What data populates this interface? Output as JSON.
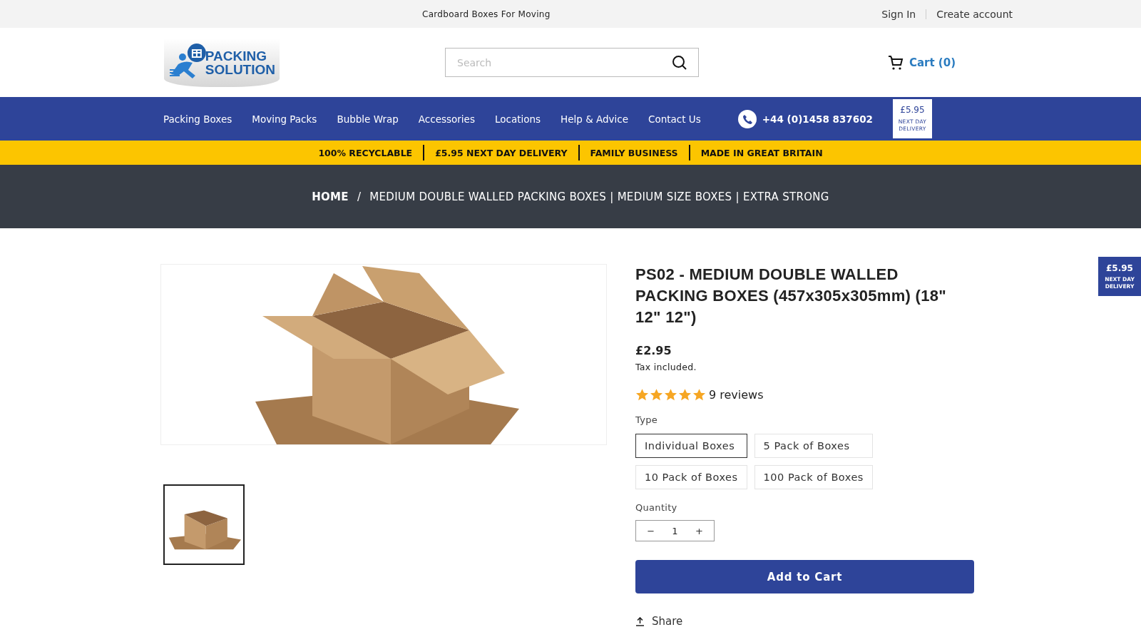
{
  "announcement": "Cardboard Boxes For Moving",
  "account_links": [
    "Sign In",
    "Create account"
  ],
  "logo": {
    "line_1": "PACKING",
    "line_2": "SOLUTION"
  },
  "search": {
    "placeholder": "Search"
  },
  "cart": {
    "label": "Cart (0)"
  },
  "nav": [
    {
      "label": "Packing Boxes"
    },
    {
      "label": "Moving Packs"
    },
    {
      "label": "Bubble Wrap"
    },
    {
      "label": "Accessories"
    },
    {
      "label": "Locations"
    },
    {
      "label": "Help & Advice"
    },
    {
      "label": "Contact Us"
    }
  ],
  "phone": "+44 (0)1458 837602",
  "delivery_badge": {
    "price": "£5.95",
    "line_1": "NEXT DAY",
    "line_2": "DELIVERY"
  },
  "usp_strip": [
    "100% RECYCLABLE",
    "£5.95 NEXT DAY DELIVERY",
    "FAMILY BUSINESS",
    "MADE IN GREAT BRITAIN"
  ],
  "breadcrumb": {
    "home": "HOME",
    "separator": "/",
    "current": "MEDIUM DOUBLE WALLED PACKING BOXES | MEDIUM SIZE BOXES | EXTRA STRONG"
  },
  "gallery": {
    "thumbnails": [
      {
        "selected": true
      }
    ]
  },
  "product": {
    "title": "PS02 - MEDIUM DOUBLE WALLED PACKING BOXES (457x305x305mm) (18\" 12\" 12\")",
    "price": "£2.95",
    "tax_note": "Tax included.",
    "stars": 5,
    "reviews": "9 reviews",
    "type_label": "Type",
    "types": [
      {
        "label": "Individual Boxes",
        "selected": true
      },
      {
        "label": "5 Pack of Boxes",
        "selected": false
      },
      {
        "label": "10 Pack of Boxes",
        "selected": false
      },
      {
        "label": "100 Pack of Boxes",
        "selected": false
      }
    ],
    "quantity_label": "Quantity",
    "quantity_minus": "−",
    "quantity": "1",
    "quantity_plus": "+",
    "add_to_cart": "Add to Cart",
    "share": "Share"
  },
  "side_badge": {
    "price": "£5.95",
    "line_1": "NEXT DAY",
    "line_2": "DELIVERY"
  }
}
